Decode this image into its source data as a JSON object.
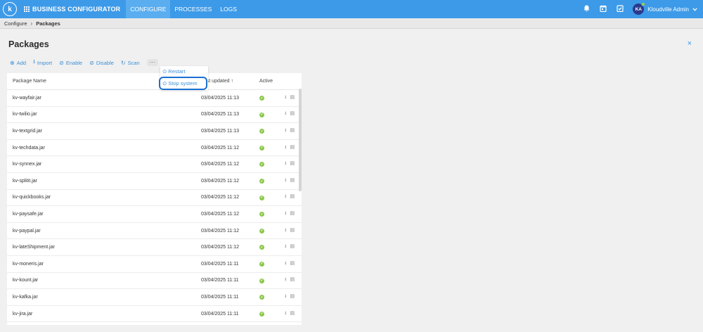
{
  "topbar": {
    "logo": "k",
    "app_name": "BUSINESS CONFIGURATOR",
    "nav": [
      {
        "label": "CONFIGURE",
        "active": true
      },
      {
        "label": "PROCESSES",
        "active": false
      },
      {
        "label": "LOGS",
        "active": false
      }
    ],
    "user": {
      "initials": "KA",
      "name": "Kloudville Admin"
    },
    "icons": [
      "bell-icon",
      "calendar-icon",
      "checklist-icon"
    ]
  },
  "breadcrumb": {
    "parent": "Configure",
    "current": "Packages"
  },
  "page": {
    "title": "Packages",
    "close": "×"
  },
  "toolbar": {
    "add": "Add",
    "import": "Import",
    "enable": "Enable",
    "disable": "Disable",
    "scan": "Scan",
    "more": "···"
  },
  "dropdown": {
    "restart": "Restart",
    "stop_system": "Stop system"
  },
  "table": {
    "headers": {
      "name": "Package Name",
      "updated": "Last updated",
      "active": "Active"
    },
    "rows": [
      {
        "name": "kv-wayfair.jar",
        "updated": "03/04/2025 11:13"
      },
      {
        "name": "kv-twilio.jar",
        "updated": "03/04/2025 11:13"
      },
      {
        "name": "kv-textgrid.jar",
        "updated": "03/04/2025 11:13"
      },
      {
        "name": "kv-techdata.jar",
        "updated": "03/04/2025 11:12"
      },
      {
        "name": "kv-synnex.jar",
        "updated": "03/04/2025 11:12"
      },
      {
        "name": "kv-splitit.jar",
        "updated": "03/04/2025 11:12"
      },
      {
        "name": "kv-quickbooks.jar",
        "updated": "03/04/2025 11:12"
      },
      {
        "name": "kv-paysafe.jar",
        "updated": "03/04/2025 11:12"
      },
      {
        "name": "kv-paypal.jar",
        "updated": "03/04/2025 11:12"
      },
      {
        "name": "kv-lateShipment.jar",
        "updated": "03/04/2025 11:12"
      },
      {
        "name": "kv-moneris.jar",
        "updated": "03/04/2025 11:11"
      },
      {
        "name": "kv-kount.jar",
        "updated": "03/04/2025 11:11"
      },
      {
        "name": "kv-kafka.jar",
        "updated": "03/04/2025 11:11"
      },
      {
        "name": "kv-jira.jar",
        "updated": "03/04/2025 11:11"
      }
    ]
  },
  "colors": {
    "accent": "#3d9ae8",
    "active_check": "#8cc84b",
    "link": "#3d8fd6"
  }
}
